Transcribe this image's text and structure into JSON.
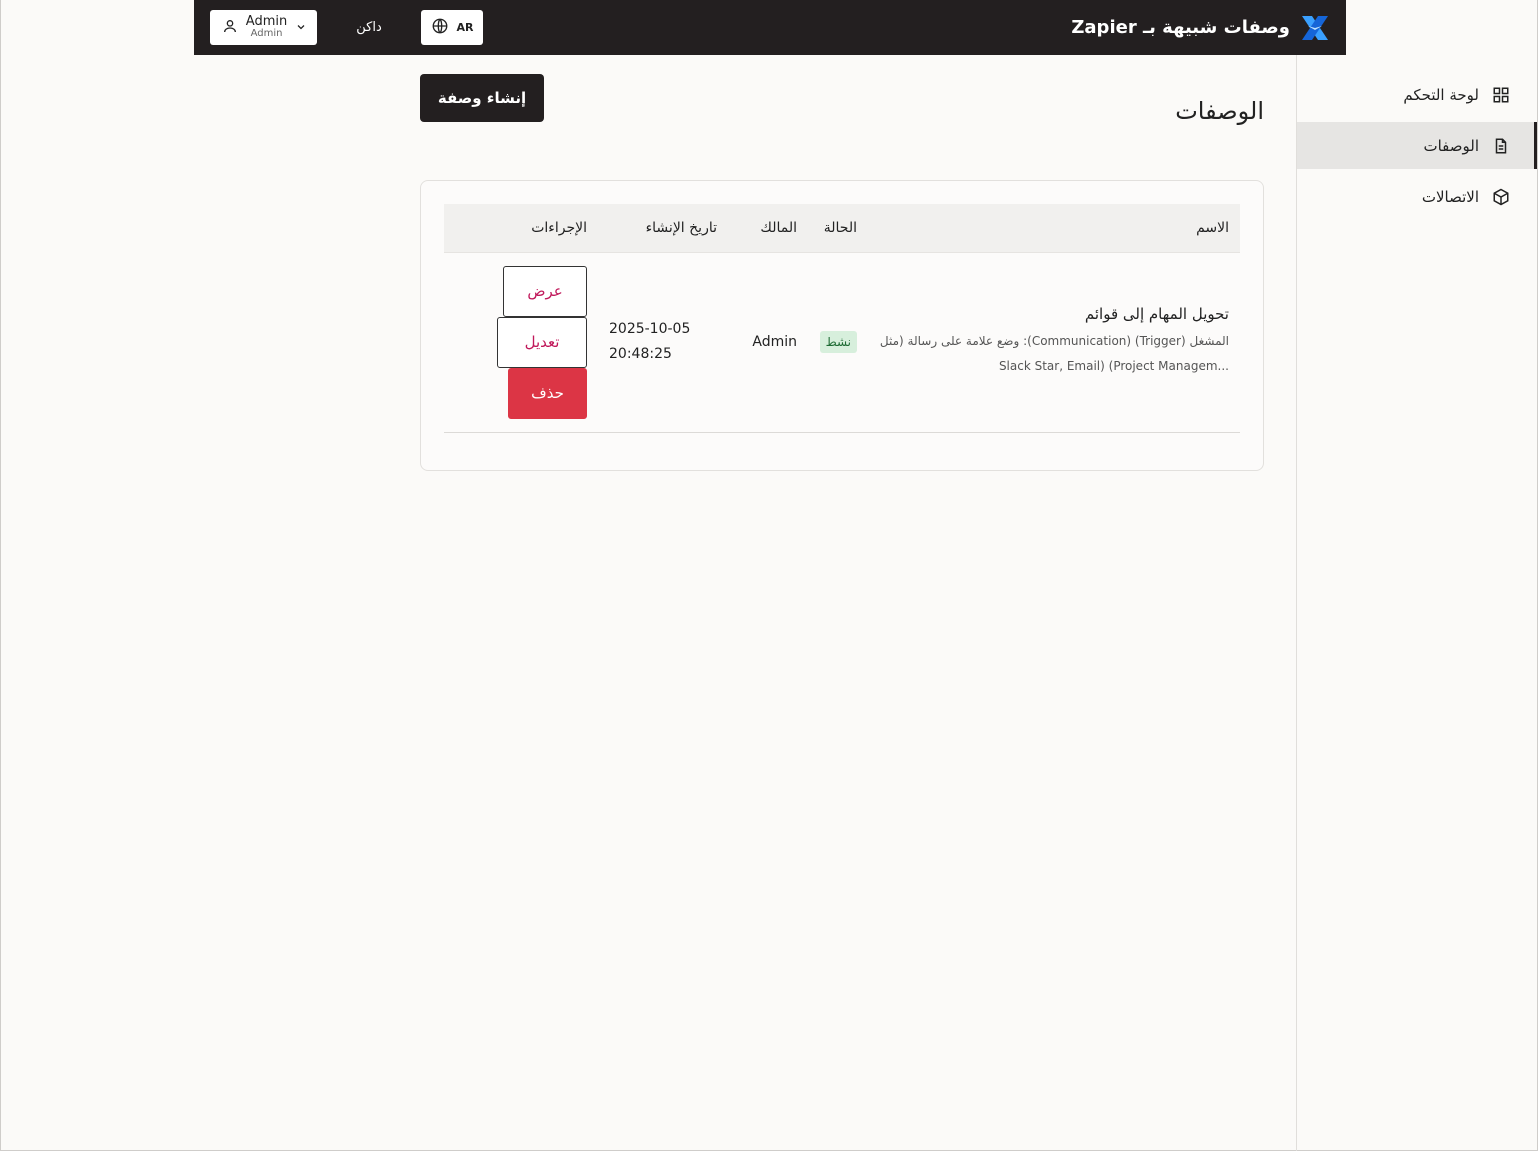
{
  "header": {
    "brand_title": "وصفات شبيهة بـ Zapier",
    "lang_label": "AR",
    "theme_label": "داكن",
    "user_name": "Admin",
    "user_role": "Admin"
  },
  "sidebar": {
    "items": [
      {
        "label": "لوحة التحكم",
        "icon": "grid-icon",
        "active": false
      },
      {
        "label": "الوصفات",
        "icon": "document-icon",
        "active": true
      },
      {
        "label": "الاتصالات",
        "icon": "cube-icon",
        "active": false
      }
    ]
  },
  "main": {
    "title": "الوصفات",
    "create_label": "إنشاء وصفة"
  },
  "table": {
    "columns": [
      "الاسم",
      "الحالة",
      "المالك",
      "تاريخ الإنشاء",
      "الإجراءات"
    ],
    "rows": [
      {
        "name": "تحويل المهام إلى قوائم",
        "desc_line1": "المشغل (Trigger) (Communication): وضع علامة على رسالة (مثل",
        "desc_line2": "...Slack Star, Email) (Project Managem",
        "status": "نشط",
        "owner": "Admin",
        "date": "2025-10-05",
        "time": "20:48:25",
        "actions": {
          "view": "عرض",
          "edit": "تعديل",
          "delete": "حذف"
        }
      }
    ]
  },
  "colors": {
    "header_bg": "#231f20",
    "accent_text": "#c0185a",
    "danger": "#dc3545",
    "badge_bg": "#d7efdc",
    "badge_text": "#1e6b34"
  }
}
